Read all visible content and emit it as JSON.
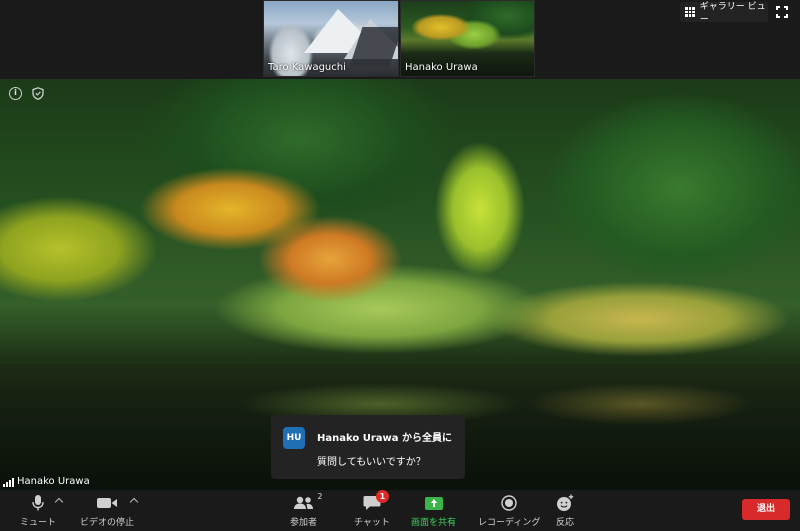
{
  "thumbnails": [
    {
      "name": "Taro Kawaguchi"
    },
    {
      "name": "Hanako Urawa"
    }
  ],
  "gallery_view": {
    "label": "ギャラリー ビュー",
    "icon": "grid-icon"
  },
  "fullscreen": {
    "icon": "fullscreen-icon"
  },
  "main_video": {
    "speaker_name": "Hanako Urawa",
    "info_icon_glyph": "i",
    "info_icon": "info-icon",
    "security_icon": "shield-icon"
  },
  "chat_toast": {
    "avatar_initials": "HU",
    "from": "Hanako Urawa から全員に",
    "message": "質問してもいいですか？"
  },
  "toolbar": {
    "mute": {
      "label": "ミュート",
      "icon": "microphone-icon"
    },
    "video": {
      "label": "ビデオの停止",
      "icon": "video-camera-icon"
    },
    "participants": {
      "label": "参加者",
      "icon": "participants-icon",
      "count": "2"
    },
    "chat": {
      "label": "チャット",
      "icon": "chat-icon",
      "badge": "1"
    },
    "share": {
      "label": "画面を共有",
      "icon": "share-screen-icon",
      "color": "#3bb54a"
    },
    "record": {
      "label": "レコーディング",
      "icon": "record-icon"
    },
    "reactions": {
      "label": "反応",
      "icon": "emoji-icon"
    },
    "leave": {
      "label": "退出",
      "color": "#d82a2a"
    }
  }
}
